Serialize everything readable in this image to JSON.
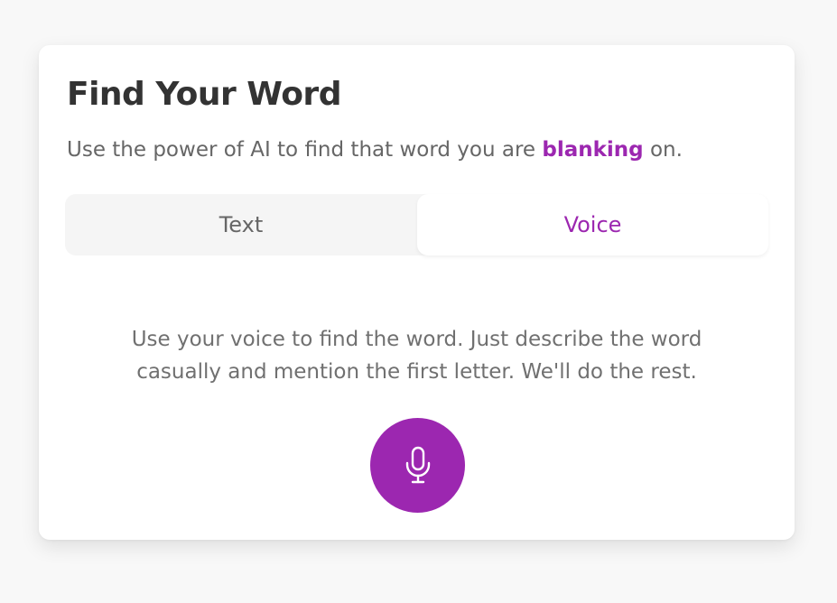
{
  "card": {
    "title": "Find Your Word",
    "subtitle_before": "Use the power of AI to find that word you are ",
    "subtitle_highlight": "blanking",
    "subtitle_after": " on."
  },
  "tabs": [
    {
      "label": "Text",
      "selected": false
    },
    {
      "label": "Voice",
      "selected": true
    }
  ],
  "voice": {
    "instructions": "Use your voice to find the word. Just describe the word casually and mention the first letter. We'll do the rest.",
    "mic_icon": "microphone-icon"
  },
  "colors": {
    "accent": "#9c27b0",
    "background": "#f8f8f8",
    "card": "#ffffff",
    "title": "#333333",
    "body_text": "#666666",
    "tab_track": "#f5f5f5"
  }
}
